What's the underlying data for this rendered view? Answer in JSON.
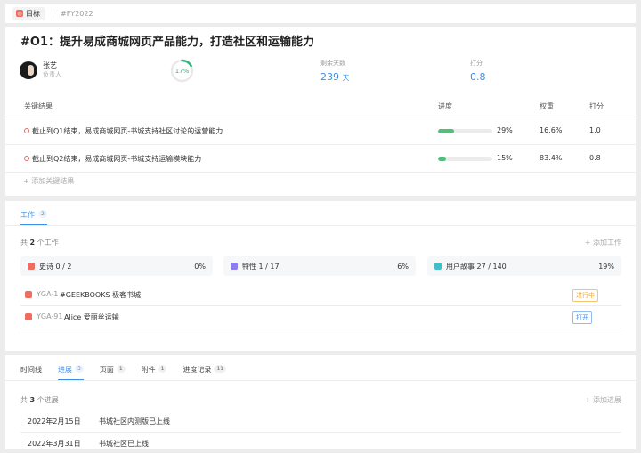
{
  "topbar": {
    "tag_label": "目标",
    "crumb": "#FY2022"
  },
  "objective": {
    "title": "#O1：提升易成商城网页产品能力，打造社区和运输能力",
    "owner_name": "张艺",
    "owner_role": "负责人",
    "progress_label": "17%",
    "progress_value": 0.17,
    "remaining_label": "剩余天数",
    "remaining_value": "239",
    "remaining_unit": "天",
    "score_label": "打分",
    "score_value": "0.8"
  },
  "key_results": {
    "headers": [
      "关键结果",
      "进度",
      "权重",
      "打分"
    ],
    "rows": [
      {
        "text": "截止到Q1结束，易成商城网页-书城支持社区讨论的运营能力",
        "progress": 0.29,
        "progress_label": "29%",
        "weight": "16.6%",
        "score": "1.0"
      },
      {
        "text": "截止到Q2结束，易成商城网页-书城支持运输模块能力",
        "progress": 0.15,
        "progress_label": "15%",
        "weight": "83.4%",
        "score": "0.8"
      }
    ],
    "add_label": "添加关键结果"
  },
  "work": {
    "tab_label": "工作",
    "tab_count": "2",
    "count_prefix": "共",
    "count_num": "2",
    "count_suffix": "个工作",
    "add_label": "添加工作",
    "summary": [
      {
        "label": "史诗  0 / 2",
        "pct": "0%",
        "color": "#f26b60"
      },
      {
        "label": "特性  1 / 17",
        "pct": "6%",
        "color": "#8c7cf0"
      },
      {
        "label": "用户故事  27 / 140",
        "pct": "19%",
        "color": "#3fc0c8"
      }
    ],
    "items": [
      {
        "id": "YGA-1",
        "name": "#GEEKBOOKS 极客书城",
        "status": "进行中",
        "status_color": "#f5a623"
      },
      {
        "id": "YGA-91",
        "name": "Alice 爱丽丝运输",
        "status": "打开",
        "status_color": "#3d8ee8"
      }
    ]
  },
  "progress_section": {
    "tabs": [
      {
        "label": "时间线",
        "count": ""
      },
      {
        "label": "进展",
        "count": "3"
      },
      {
        "label": "页面",
        "count": "1"
      },
      {
        "label": "附件",
        "count": "1"
      },
      {
        "label": "进度记录",
        "count": "11"
      }
    ],
    "count_prefix": "共",
    "count_num": "3",
    "count_suffix": "个进展",
    "add_label": "添加进展",
    "items": [
      {
        "date": "2022年2月15日",
        "text": "书城社区内测版已上线"
      },
      {
        "date": "2022年3月31日",
        "text": "书城社区已上线"
      }
    ]
  }
}
